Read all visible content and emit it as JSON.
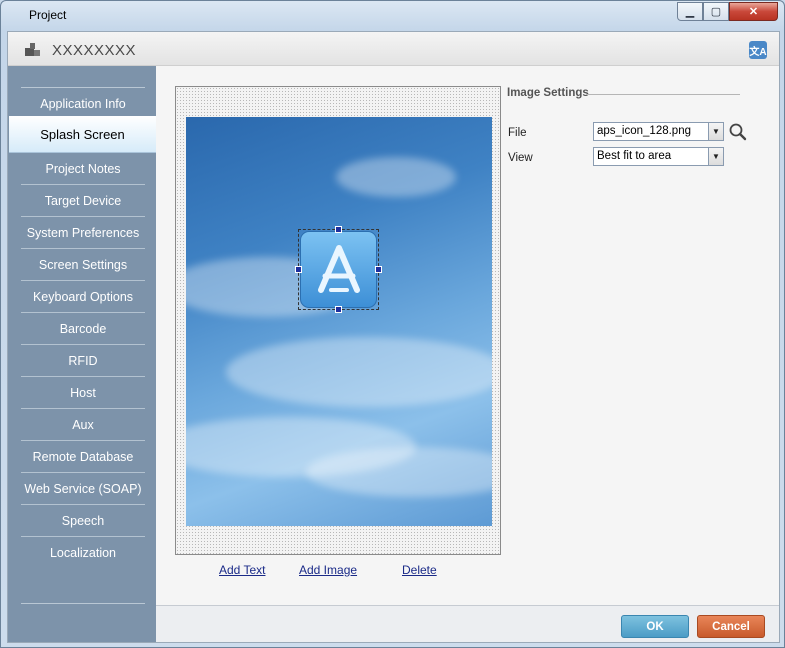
{
  "window": {
    "title": "Project",
    "min_icon": "minimize-icon",
    "max_icon": "maximize-icon",
    "close_icon": "close-icon"
  },
  "header": {
    "project_name": "XXXXXXXX",
    "project_icon": "project-icon",
    "language_icon": "translate-icon"
  },
  "sidebar": {
    "items": [
      {
        "label": "Application Info"
      },
      {
        "label": "Splash Screen"
      },
      {
        "label": "Project Notes"
      },
      {
        "label": "Target Device"
      },
      {
        "label": "System Preferences"
      },
      {
        "label": "Screen Settings"
      },
      {
        "label": "Keyboard Options"
      },
      {
        "label": "Barcode"
      },
      {
        "label": "RFID"
      },
      {
        "label": "Host"
      },
      {
        "label": "Aux"
      },
      {
        "label": "Remote Database"
      },
      {
        "label": "Web Service (SOAP)"
      },
      {
        "label": "Speech"
      },
      {
        "label": "Localization"
      }
    ],
    "active_index": 1
  },
  "preview": {
    "add_text": "Add Text",
    "add_image": "Add Image",
    "delete": "Delete",
    "image_icon": "app-store-icon"
  },
  "image_settings": {
    "title": "Image Settings",
    "file_label": "File",
    "file_value": "aps_icon_128.png",
    "view_label": "View",
    "view_value": "Best fit to area",
    "search_icon": "magnifier-icon"
  },
  "footer": {
    "ok": "OK",
    "cancel": "Cancel"
  },
  "colors": {
    "sidebar": "#7d93aa",
    "ok_button": "#4b9cc6",
    "cancel_button": "#c85a2b",
    "link": "#1a2a88"
  }
}
